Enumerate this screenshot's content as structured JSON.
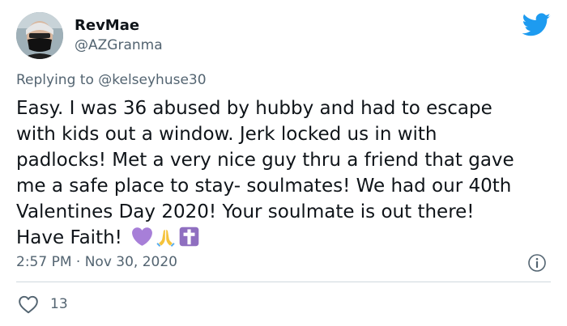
{
  "author": {
    "display_name": "RevMae",
    "handle": "@AZGranma"
  },
  "reply": {
    "prefix": "Replying to ",
    "mention": "@kelseyhuse30"
  },
  "tweet": {
    "lines": [
      "Easy. I was 36 abused by hubby and had to escape",
      "with kids out a window. Jerk locked us in with",
      "padlocks! Met a very nice guy thru a friend that gave",
      "me a safe place to stay- soulmates! We had our 40th",
      "Valentines Day 2020! Your soulmate is out there!",
      "Have Faith!"
    ],
    "emojis": [
      "purple-heart-icon",
      "folded-hands-icon",
      "latin-cross-icon"
    ],
    "timestamp": "2:57 PM · Nov 30, 2020"
  },
  "stats": {
    "likes": "13"
  },
  "colors": {
    "brand": "#1d9bf0",
    "text": "#0f1419",
    "muted": "#536471",
    "divider": "#cfd9de",
    "purple_heart": "#a77fd8",
    "cross_bg": "#8f6fc0"
  }
}
